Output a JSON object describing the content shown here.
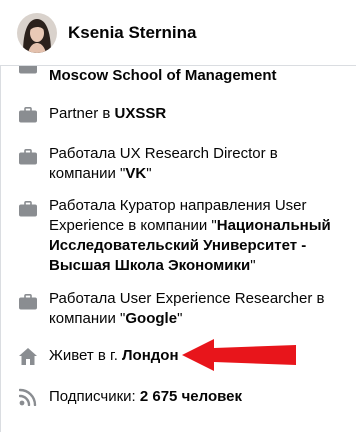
{
  "header": {
    "name": "Ksenia Sternina"
  },
  "intro": {
    "items": [
      {
        "icon": "briefcase-icon",
        "prefix": "",
        "bold": "Moscow School of Management",
        "suffix": ""
      },
      {
        "icon": "briefcase-icon",
        "prefix": "Partner в ",
        "bold": "UXSSR",
        "suffix": ""
      },
      {
        "icon": "briefcase-icon",
        "prefix": "Работала UX Research Director в компании \"",
        "bold": "VK",
        "suffix": "\""
      },
      {
        "icon": "briefcase-icon",
        "prefix": "Работала Куратор направления User Experience в компании \"",
        "bold": "Национальный Исследовательский Университет - Высшая Школа Экономики",
        "suffix": "\""
      },
      {
        "icon": "briefcase-icon",
        "prefix": "Работала User Experience Researcher в компании \"",
        "bold": "Google",
        "suffix": "\""
      },
      {
        "icon": "home-icon",
        "prefix": "Живет в г. ",
        "bold": "Лондон",
        "suffix": ""
      },
      {
        "icon": "rss-icon",
        "prefix": "Подписчики: ",
        "bold": "2 675 человек",
        "suffix": ""
      }
    ]
  },
  "colors": {
    "icon": "#8a8d91",
    "annotation_arrow": "#e8151b",
    "divider": "#dadde1"
  }
}
